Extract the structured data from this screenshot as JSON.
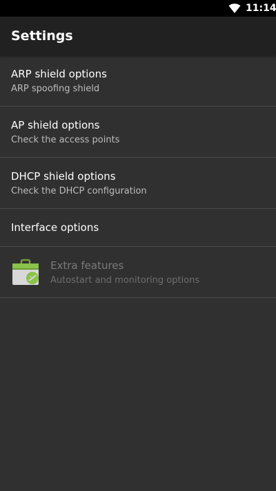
{
  "status_bar": {
    "time": "11:14",
    "wifi_icon": "wifi-icon"
  },
  "app_bar": {
    "title": "Settings"
  },
  "settings": {
    "items": [
      {
        "title": "ARP shield options",
        "summary": "ARP spoofing shield"
      },
      {
        "title": "AP shield options",
        "summary": "Check the access points"
      },
      {
        "title": "DHCP shield options",
        "summary": "Check the DHCP configuration"
      },
      {
        "title": "Interface options"
      },
      {
        "title": "Extra features",
        "summary": "Autostart and monitoring options",
        "icon": "android-market-bag-icon",
        "enabled": false
      }
    ]
  },
  "colors": {
    "background": "#303030",
    "app_bar": "#212121",
    "status_bar": "#000000",
    "primary_text": "#ffffff",
    "secondary_text": "#bdbdbd",
    "disabled_text": "#7a7a7a",
    "divider": "#4a4a4a",
    "icon_green": "#8bc34a"
  }
}
